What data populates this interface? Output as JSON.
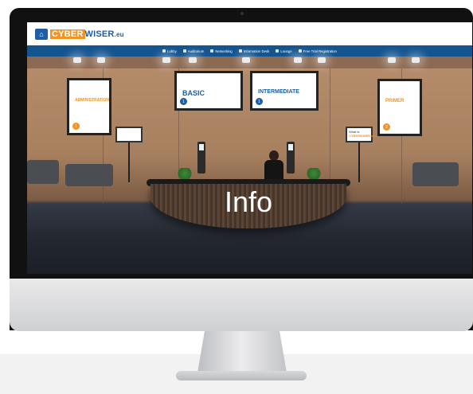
{
  "app": {
    "logo_text_prefix": "CYBER",
    "logo_text_suffix": "WISER",
    "logo_tld": ".eu"
  },
  "nav": {
    "items": [
      {
        "label": "Lobby",
        "icon": "home-icon"
      },
      {
        "label": "Auditorium",
        "icon": "grid-icon"
      },
      {
        "label": "Networking",
        "icon": "document-icon"
      },
      {
        "label": "Information Desk",
        "icon": "info-icon"
      },
      {
        "label": "Lounge",
        "icon": "chat-icon"
      },
      {
        "label": "Free Trial Registration",
        "icon": "check-icon"
      }
    ]
  },
  "posters": {
    "left": {
      "title": "ADMINISTRATION",
      "num": "1"
    },
    "basic": {
      "title": "BASIC",
      "num": "1"
    },
    "intermediate": {
      "title": "INTERMEDIATE",
      "num": "1"
    },
    "right": {
      "title": "PRIMER",
      "num": "2"
    }
  },
  "easel_right": {
    "line1": "What is",
    "line2": "CYBERWISER.eu"
  },
  "desk": {
    "label": "Info"
  },
  "colors": {
    "brand_blue": "#1d5ea6",
    "nav_blue": "#14548f",
    "brand_orange": "#f29322",
    "wall": "#b68d6c",
    "floor": "#2f3440"
  }
}
